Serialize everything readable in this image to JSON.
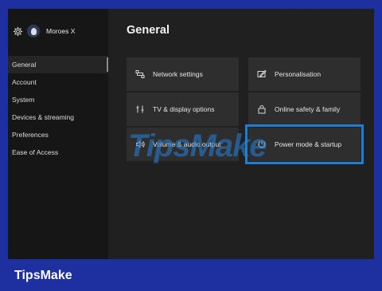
{
  "header": {
    "gamertag": "Moroes X"
  },
  "sidebar": {
    "items": [
      {
        "label": "General",
        "selected": true
      },
      {
        "label": "Account"
      },
      {
        "label": "System"
      },
      {
        "label": "Devices & streaming"
      },
      {
        "label": "Preferences"
      },
      {
        "label": "Ease of Access"
      }
    ]
  },
  "main": {
    "title": "General",
    "tiles": [
      {
        "label": "Network settings",
        "icon": "network-icon"
      },
      {
        "label": "Personalisation",
        "icon": "personalise-icon"
      },
      {
        "label": "TV & display options",
        "icon": "tv-display-icon"
      },
      {
        "label": "Online safety & family",
        "icon": "lock-icon"
      },
      {
        "label": "Volume & audio output",
        "icon": "volume-icon"
      },
      {
        "label": "Power mode & startup",
        "icon": "power-icon",
        "focused": true
      }
    ]
  },
  "watermark": "TipsMake",
  "footer": {
    "brand": "TipsMake"
  },
  "colors": {
    "frame": "#1e2fa0",
    "focus": "#1b7fd6",
    "tile": "#2e2e2e",
    "background": "#202020"
  }
}
